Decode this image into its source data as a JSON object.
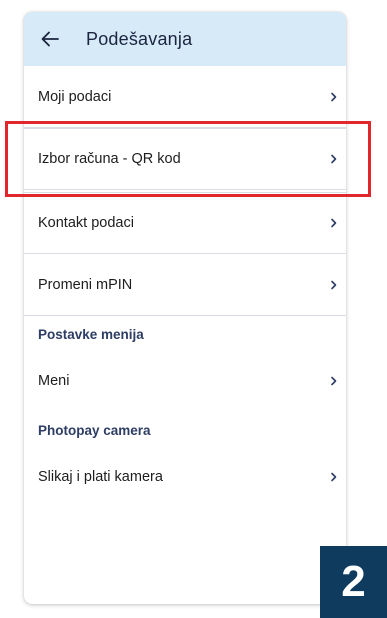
{
  "header": {
    "title": "Podešavanja",
    "back_icon": "arrow-left-icon",
    "background": "#d6eaf7"
  },
  "menu": {
    "items": [
      {
        "label": "Moji podaci"
      },
      {
        "label": "Izbor računa - QR kod"
      },
      {
        "label": "Kontakt podaci"
      },
      {
        "label": "Promeni mPIN"
      }
    ],
    "chevron_icon": "chevron-right-icon"
  },
  "sections": [
    {
      "title": "Postavke menija",
      "items": [
        {
          "label": "Meni"
        }
      ]
    },
    {
      "title": "Photopay camera",
      "items": [
        {
          "label": "Slikaj i plati kamera"
        }
      ]
    }
  ],
  "annotation": {
    "step_number": "2",
    "highlight_color": "#e1262c",
    "badge_color": "#0e3b5e"
  }
}
